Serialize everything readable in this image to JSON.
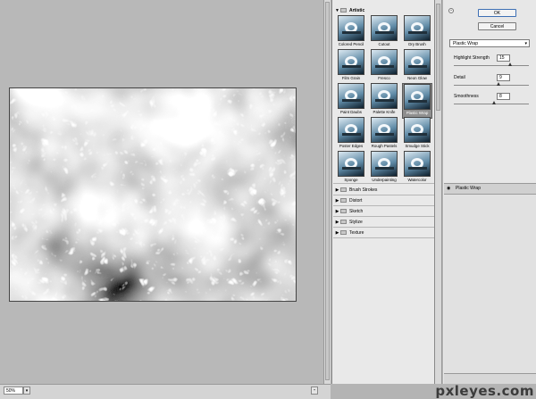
{
  "preview": {
    "zoom": "50%",
    "zoom_arrow": "▾",
    "zoom_minus": "-"
  },
  "gallery": {
    "open_category": "Artistic",
    "filters": [
      "Colored Pencil",
      "Cutout",
      "Dry Brush",
      "Film Grain",
      "Fresco",
      "Neon Glow",
      "Paint Daubs",
      "Palette Knife",
      "Plastic Wrap",
      "Poster Edges",
      "Rough Pastels",
      "Smudge Stick",
      "Sponge",
      "Underpainting",
      "Watercolor"
    ],
    "selected_filter": "Plastic Wrap",
    "categories": [
      "Brush Strokes",
      "Distort",
      "Sketch",
      "Stylize",
      "Texture"
    ]
  },
  "buttons": {
    "ok": "OK",
    "cancel": "Cancel"
  },
  "settings": {
    "filter": "Plastic Wrap",
    "params": [
      {
        "label": "Highlight Strength",
        "value": "15",
        "fraction": 0.75
      },
      {
        "label": "Detail",
        "value": "9",
        "fraction": 0.6
      },
      {
        "label": "Smoothness",
        "value": "8",
        "fraction": 0.53
      }
    ]
  },
  "effect_layers": [
    {
      "name": "Plastic Wrap"
    }
  ],
  "icons": {
    "collapse": "chevron-up-icon",
    "eye": "eye-icon",
    "folder": "folder-icon",
    "triangle": "disclosure-triangle-icon"
  },
  "watermark": "pxleyes.com",
  "colors": {
    "ok_border": "#3d6fb4",
    "selected_thumb": "#8f8f8f"
  }
}
